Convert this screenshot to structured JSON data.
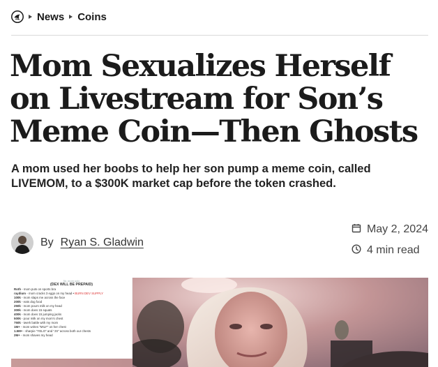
{
  "breadcrumb": {
    "logo_icon": "daily-beast-logo-icon",
    "items": [
      "News",
      "Coins"
    ]
  },
  "article": {
    "headline": "Mom Sexualizes Herself on Livestream for Son’s Meme Coin—Then Ghosts",
    "dek": "A mom used her boobs to help her son pump a meme coin, called LIVEMOM, to a $300K market cap before the token crashed.",
    "byline_prefix": "By",
    "author": "Ryan S. Gladwin",
    "date": "May 2, 2024",
    "read_time": "4 min read",
    "calendar_icon": "calendar-icon",
    "clock_icon": "clock-icon"
  },
  "hero_image": {
    "panel_header": "5k: mom solo",
    "panel_title": "(DEX WILL BE PREPAID)",
    "rows": [
      {
        "amount": "Roth",
        "text": "- mom puts on sports bra"
      },
      {
        "amount": "raydium",
        "text": "- mom cracks 3 eggs on my head •",
        "highlight": "BURN DEV SUPPLY"
      },
      {
        "amount": "100k",
        "text": "- mom slaps me across the face"
      },
      {
        "amount": "200k",
        "text": "- eats dog food"
      },
      {
        "amount": "250k",
        "text": "- mom pours milk on my head"
      },
      {
        "amount": "300k",
        "text": "- mom does 15 squats"
      },
      {
        "amount": "400k",
        "text": "- mom does 15 jumping jacks"
      },
      {
        "amount": "500k",
        "text": "- pour milk on my mom's chest"
      },
      {
        "amount": "750k",
        "text": "- twerk battle with my mom"
      },
      {
        "amount": "1M+",
        "text": "- mom writes \"MILF\" on her chest"
      },
      {
        "amount": "1.5M+",
        "text": "- sharpie \"YELO\" and \"JS\" across both our chests"
      },
      {
        "amount": "2M+",
        "text": "- mom shaves my head"
      }
    ]
  }
}
